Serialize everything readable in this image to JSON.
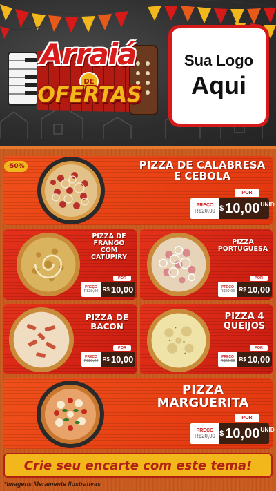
{
  "header": {
    "title_main": "Arraiá",
    "title_de": "DE",
    "title_sub": "OFERTAS",
    "logo_line1": "Sua Logo",
    "logo_line2": "Aqui"
  },
  "discount_badge": "-50%",
  "labels": {
    "preco": "PREÇO",
    "por": "POR",
    "currency": "R$",
    "unit": "UNID"
  },
  "products": [
    {
      "name_lines": [
        "PIZZA DE CALABRESA",
        "E CEBOLA"
      ],
      "old_price": "R$20,00",
      "new_price": "10,00"
    },
    {
      "name_lines": [
        "PIZZA DE",
        "FRANGO",
        "COM",
        "CATUPIRY"
      ],
      "old_price": "R$20,00",
      "new_price": "10,00"
    },
    {
      "name_lines": [
        "PIZZA",
        "PORTUGUESA"
      ],
      "old_price": "R$20,00",
      "new_price": "10,00"
    },
    {
      "name_lines": [
        "PIZZA DE",
        "BACON"
      ],
      "old_price": "R$20,00",
      "new_price": "10,00"
    },
    {
      "name_lines": [
        "PIZZA 4",
        "QUEIJOS"
      ],
      "old_price": "R$20,00",
      "new_price": "10,00"
    },
    {
      "name_lines": [
        "PIZZA",
        "MARGUERITA"
      ],
      "old_price": "R$20,00",
      "new_price": "10,00"
    }
  ],
  "banner": "Crie seu encarte com este tema!",
  "footnote": "*Imagens Meramente Ilustrativas",
  "colors": {
    "brand_red": "#d61a1a",
    "yellow": "#f2b81b",
    "card_orange": "#f0501a",
    "wood": "#c4581d"
  }
}
